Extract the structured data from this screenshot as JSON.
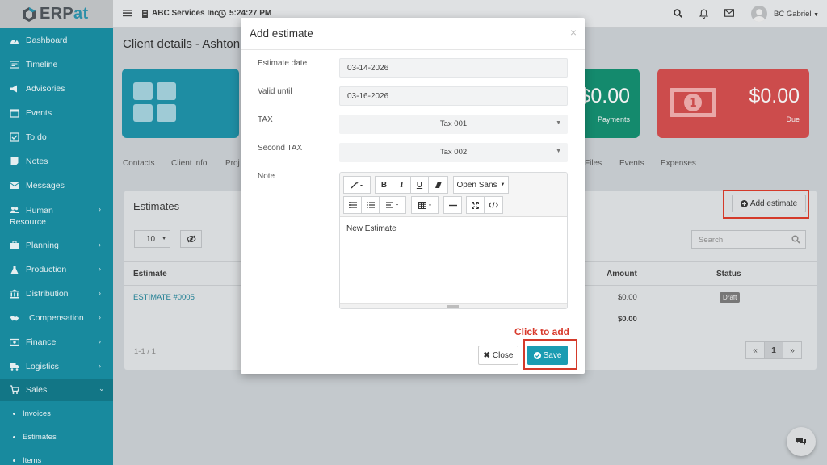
{
  "app": {
    "logo_prefix": "ERP",
    "logo_suffix": "at"
  },
  "topbar": {
    "company": "ABC Services Inc.",
    "time": "5:24:27 PM",
    "user": "BC Gabriel"
  },
  "sidebar": {
    "items": [
      {
        "label": "Dashboard",
        "icon": "dashboard-icon"
      },
      {
        "label": "Timeline",
        "icon": "timeline-icon"
      },
      {
        "label": "Advisories",
        "icon": "megaphone-icon"
      },
      {
        "label": "Events",
        "icon": "calendar-icon"
      },
      {
        "label": "To do",
        "icon": "checkbox-icon"
      },
      {
        "label": "Notes",
        "icon": "notes-icon"
      },
      {
        "label": "Messages",
        "icon": "envelope-icon"
      },
      {
        "label": "Human Resource",
        "icon": "users-icon"
      },
      {
        "label": "Planning",
        "icon": "briefcase-icon"
      },
      {
        "label": "Production",
        "icon": "flask-icon"
      },
      {
        "label": "Distribution",
        "icon": "bank-icon"
      },
      {
        "label": "Compensation",
        "icon": "handshake-icon"
      },
      {
        "label": "Finance",
        "icon": "money-icon"
      },
      {
        "label": "Logistics",
        "icon": "truck-icon"
      },
      {
        "label": "Sales",
        "icon": "cart-icon"
      }
    ],
    "sub_items": [
      "Invoices",
      "Estimates",
      "Items"
    ]
  },
  "page": {
    "title": "Client details - Ashton",
    "cards": {
      "payments_amount": "$0.00",
      "payments_label": "Payments",
      "due_amount": "$0.00",
      "due_label": "Due"
    },
    "tabs": [
      "Contacts",
      "Client info",
      "Proj",
      "Files",
      "Events",
      "Expenses"
    ],
    "panel_title": "Estimates",
    "add_estimate": "Add estimate",
    "page_size": "10",
    "search_placeholder": "Search",
    "columns": {
      "estimate": "Estimate",
      "amount": "Amount",
      "status": "Status"
    },
    "rows": [
      {
        "estimate": "ESTIMATE #0005",
        "amount": "$0.00",
        "status": "Draft"
      }
    ],
    "total": "$0.00",
    "pager_info": "1-1 / 1",
    "pager": {
      "prev": "«",
      "current": "1",
      "next": "»"
    }
  },
  "modal": {
    "title": "Add estimate",
    "close_glyph": "×",
    "fields": {
      "estimate_date_label": "Estimate date",
      "estimate_date": "03-14-2026",
      "valid_until_label": "Valid until",
      "valid_until": "03-16-2026",
      "tax_label": "TAX",
      "tax": "Tax 001",
      "second_tax_label": "Second TAX",
      "second_tax": "Tax 002",
      "note_label": "Note"
    },
    "editor": {
      "font": "Open Sans",
      "content": "New Estimate"
    },
    "buttons": {
      "close": "Close",
      "save": "Save"
    }
  },
  "annotation": {
    "hint": "Click to add",
    "color": "#d43a2a"
  },
  "colors": {
    "accent": "#1a9cb2",
    "sidebar": "#188a9e",
    "payments": "#148a6d",
    "due": "#cc4c4c"
  }
}
